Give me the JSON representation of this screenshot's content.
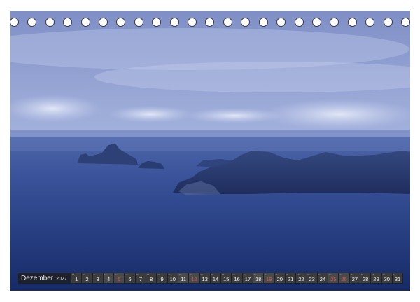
{
  "calendar": {
    "month": "Dezember",
    "year": "2027",
    "days": [
      {
        "n": "1",
        "wd": "Mi",
        "sunday": false,
        "weekend": false
      },
      {
        "n": "2",
        "wd": "Do",
        "sunday": false,
        "weekend": false
      },
      {
        "n": "3",
        "wd": "Fr",
        "sunday": false,
        "weekend": false
      },
      {
        "n": "4",
        "wd": "Sa",
        "sunday": false,
        "weekend": true
      },
      {
        "n": "5",
        "wd": "So",
        "sunday": true,
        "weekend": true
      },
      {
        "n": "6",
        "wd": "Mo",
        "sunday": false,
        "weekend": false
      },
      {
        "n": "7",
        "wd": "Di",
        "sunday": false,
        "weekend": false
      },
      {
        "n": "8",
        "wd": "Mi",
        "sunday": false,
        "weekend": false
      },
      {
        "n": "9",
        "wd": "Do",
        "sunday": false,
        "weekend": false
      },
      {
        "n": "10",
        "wd": "Fr",
        "sunday": false,
        "weekend": false
      },
      {
        "n": "11",
        "wd": "Sa",
        "sunday": false,
        "weekend": true
      },
      {
        "n": "12",
        "wd": "So",
        "sunday": true,
        "weekend": true
      },
      {
        "n": "13",
        "wd": "Mo",
        "sunday": false,
        "weekend": false
      },
      {
        "n": "14",
        "wd": "Di",
        "sunday": false,
        "weekend": false
      },
      {
        "n": "15",
        "wd": "Mi",
        "sunday": false,
        "weekend": false
      },
      {
        "n": "16",
        "wd": "Do",
        "sunday": false,
        "weekend": false
      },
      {
        "n": "17",
        "wd": "Fr",
        "sunday": false,
        "weekend": false
      },
      {
        "n": "18",
        "wd": "Sa",
        "sunday": false,
        "weekend": true
      },
      {
        "n": "19",
        "wd": "So",
        "sunday": true,
        "weekend": true
      },
      {
        "n": "20",
        "wd": "Mo",
        "sunday": false,
        "weekend": false
      },
      {
        "n": "21",
        "wd": "Di",
        "sunday": false,
        "weekend": false
      },
      {
        "n": "22",
        "wd": "Mi",
        "sunday": false,
        "weekend": false
      },
      {
        "n": "23",
        "wd": "Do",
        "sunday": false,
        "weekend": false
      },
      {
        "n": "24",
        "wd": "Fr",
        "sunday": false,
        "weekend": false
      },
      {
        "n": "25",
        "wd": "Sa",
        "sunday": true,
        "weekend": true
      },
      {
        "n": "26",
        "wd": "So",
        "sunday": true,
        "weekend": true
      },
      {
        "n": "27",
        "wd": "Mo",
        "sunday": false,
        "weekend": false
      },
      {
        "n": "28",
        "wd": "Di",
        "sunday": false,
        "weekend": false
      },
      {
        "n": "29",
        "wd": "Mi",
        "sunday": false,
        "weekend": false
      },
      {
        "n": "30",
        "wd": "Do",
        "sunday": false,
        "weekend": false
      },
      {
        "n": "31",
        "wd": "Fr",
        "sunday": false,
        "weekend": false
      }
    ]
  },
  "colors": {
    "sky_top": "#8596c9",
    "sky_mid": "#a9b6dc",
    "sea_top": "#4d66a8",
    "sea_deep": "#1c2e6b",
    "land": "#2b3c6e",
    "land_dark": "#1a2552",
    "sunday_red": "#d9534f"
  }
}
